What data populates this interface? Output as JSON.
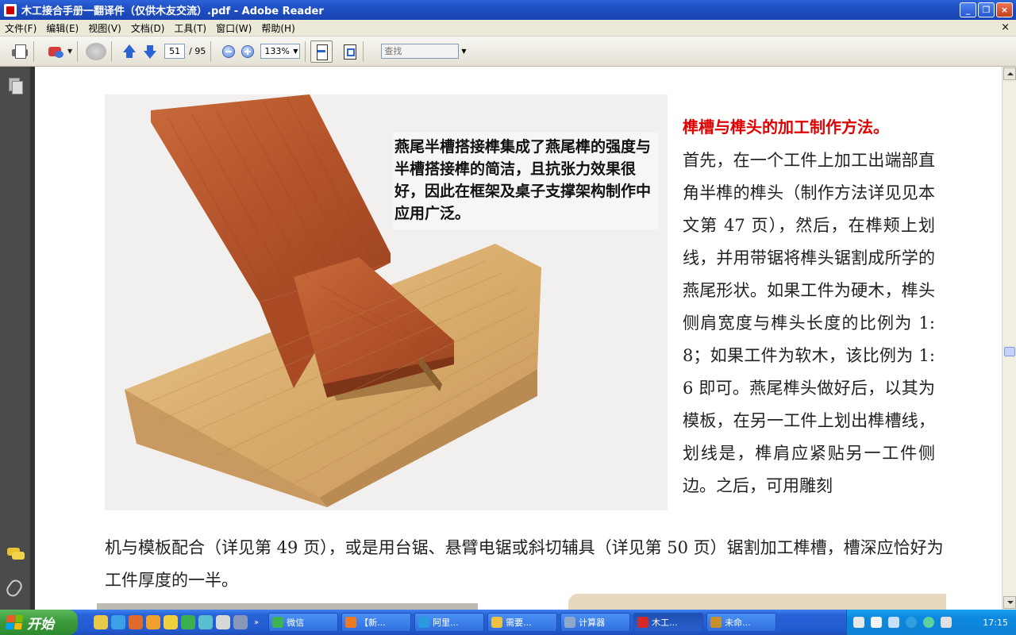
{
  "window": {
    "title": "木工接合手册一翻译件（仅供木友交流）.pdf - Adobe Reader",
    "buttons": {
      "minimize": "_",
      "maximize": "❐",
      "close": "×"
    }
  },
  "menu": {
    "items": [
      "文件(F)",
      "编辑(E)",
      "视图(V)",
      "文档(D)",
      "工具(T)",
      "窗口(W)",
      "帮助(H)"
    ],
    "close_doc": "×"
  },
  "toolbar": {
    "page_current": "51",
    "page_total": "/ 95",
    "zoom": "133%",
    "search_placeholder": "查找"
  },
  "document": {
    "caption": "燕尾半槽搭接榫集成了燕尾榫的强度与半槽搭接榫的简洁，且抗张力效果很好，因此在框架及桌子支撑架构制作中应用广泛。",
    "heading": "榫槽与榫头的加工制作方法。",
    "side_text": "首先，在一个工件上加工出端部直角半榫的榫头（制作方法详见见本文第 47 页），然后，在榫颊上划线，并用带锯将榫头锯割成所学的燕尾形状。如果工件为硬木，榫头侧肩宽度与榫头长度的比例为 1:8；如果工件为软木，该比例为 1:6 即可。燕尾榫头做好后，以其为模板，在另一工件上划出榫槽线，划线是，榫肩应紧贴另一工件侧边。之后，可用雕刻",
    "bottom_text": "机与模板配合（详见第 49 页），或是用台锯、悬臂电锯或斜切辅具（详见第 50 页）锯割加工榫槽，槽深应恰好为工件厚度的一半。"
  },
  "taskbar": {
    "start_label": "开始",
    "quicklaunch_more": "»",
    "tasks": [
      {
        "label": "微信",
        "color": "#3fb34f"
      },
      {
        "label": "【新...",
        "color": "#f07a24"
      },
      {
        "label": "阿里...",
        "color": "#2a9ae0"
      },
      {
        "label": "需要...",
        "color": "#f0c040"
      },
      {
        "label": "计算器",
        "color": "#8fa8c8"
      },
      {
        "label": "木工...",
        "color": "#d42a2a"
      },
      {
        "label": "未命...",
        "color": "#c8902a"
      }
    ],
    "clock": "17:15"
  }
}
